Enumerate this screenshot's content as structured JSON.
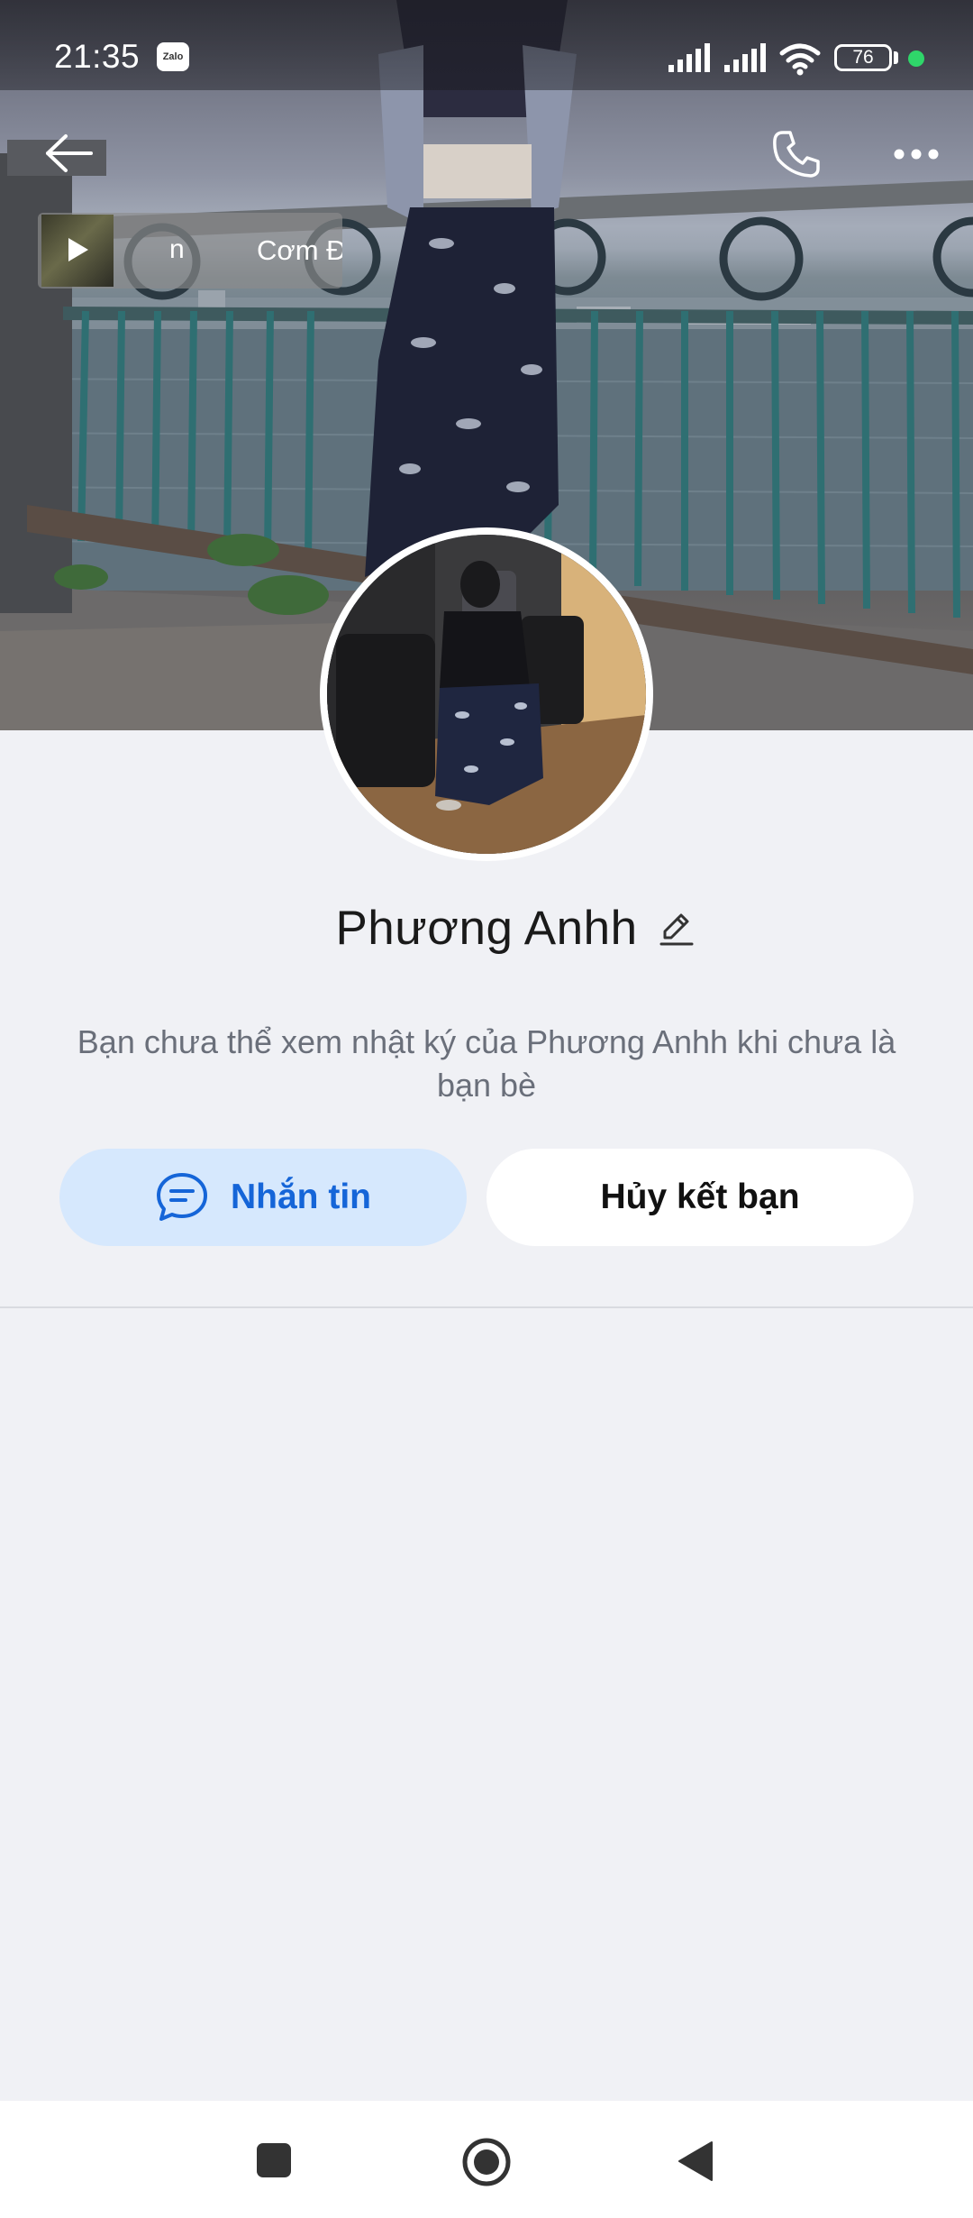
{
  "status_bar": {
    "time": "21:35",
    "app_badge": "Zalo",
    "battery_level": "76"
  },
  "music": {
    "scroll_left": "n",
    "scroll_right": "Cơm Đo"
  },
  "profile": {
    "name": "Phương Anhh",
    "privacy_note": "Bạn chưa thể xem nhật ký của Phương Anhh khi chưa là bạn bè"
  },
  "actions": {
    "message_label": "Nhắn tin",
    "unfriend_label": "Hủy kết bạn"
  },
  "colors": {
    "accent": "#1565d8",
    "message_button_bg": "#d6e8fd",
    "background": "#f0f1f5"
  }
}
